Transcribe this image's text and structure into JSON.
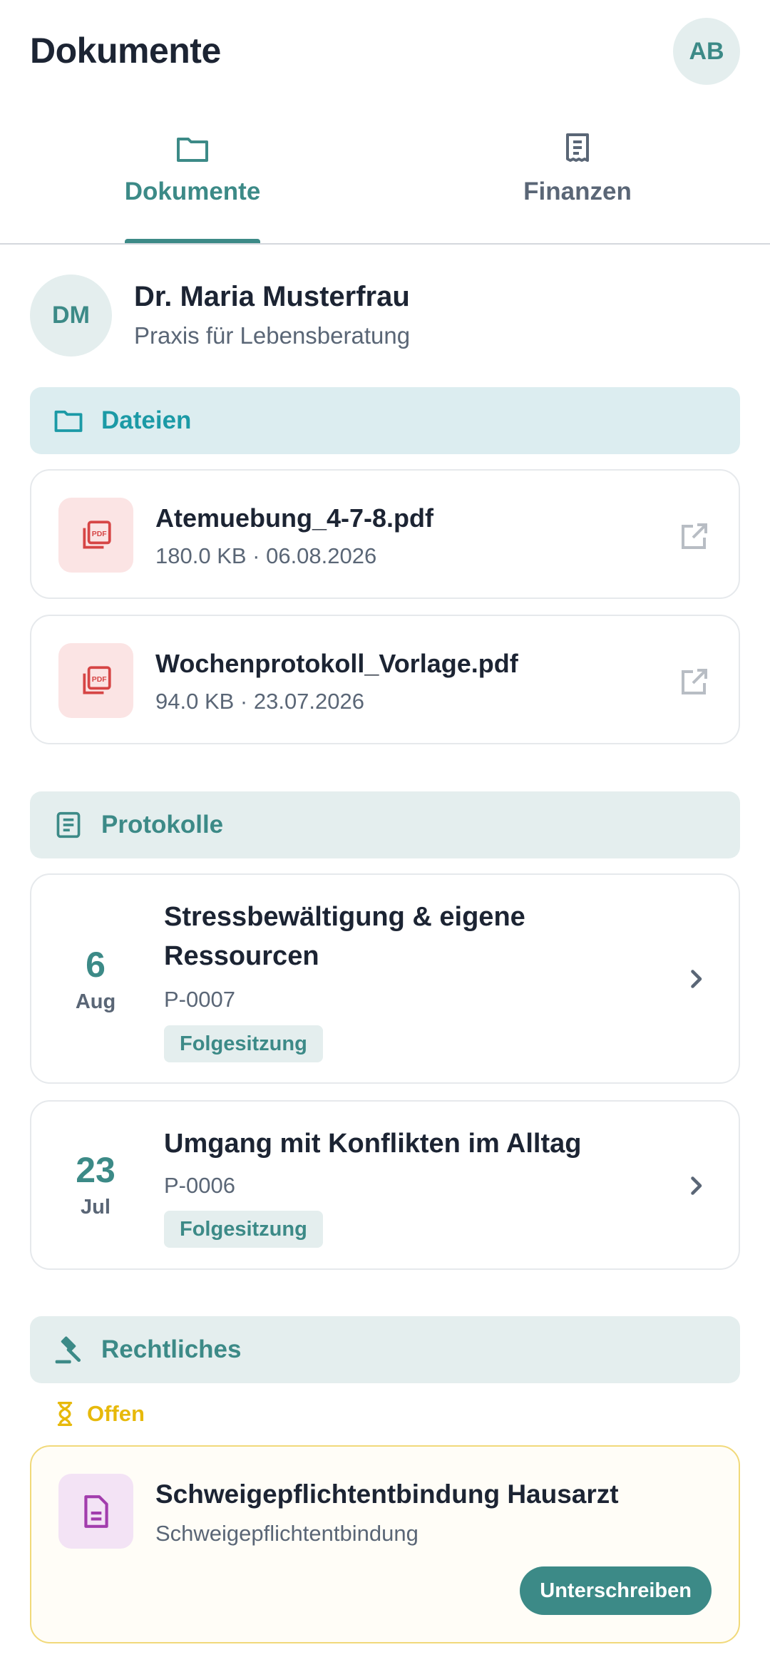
{
  "header": {
    "title": "Dokumente",
    "user_initials": "AB"
  },
  "tabs": [
    {
      "label": "Dokumente",
      "icon": "folder-icon",
      "active": true
    },
    {
      "label": "Finanzen",
      "icon": "receipt-icon",
      "active": false
    }
  ],
  "provider": {
    "initials": "DM",
    "name": "Dr. Maria Musterfrau",
    "subtitle": "Praxis für Lebensberatung"
  },
  "sections": {
    "files": {
      "title": "Dateien",
      "icon": "folder-icon"
    },
    "protocols": {
      "title": "Protokolle",
      "icon": "document-list-icon"
    },
    "legal": {
      "title": "Rechtliches",
      "icon": "gavel-icon"
    }
  },
  "files": [
    {
      "name": "Atemuebung_4-7-8.pdf",
      "meta": "180.0 KB · 06.08.2026",
      "icon": "pdf-icon"
    },
    {
      "name": "Wochenprotokoll_Vorlage.pdf",
      "meta": "94.0 KB · 23.07.2026",
      "icon": "pdf-icon"
    }
  ],
  "protocols": [
    {
      "day": "6",
      "month": "Aug",
      "title": "Stressbewältigung & eigene Ressourcen",
      "id": "P-0007",
      "badge": "Folgesitzung"
    },
    {
      "day": "23",
      "month": "Jul",
      "title": "Umgang mit Konflikten im Alltag",
      "id": "P-0006",
      "badge": "Folgesitzung"
    }
  ],
  "legal": {
    "status_label": "Offen",
    "status_icon": "hourglass-icon",
    "document": {
      "title": "Schweigepflichtentbindung Hausarzt",
      "subtitle": "Schweigepflichtentbindung",
      "button": "Unterschreiben"
    }
  },
  "colors": {
    "accent": "#3c8a87",
    "files_accent": "#1b9aa6",
    "pending": "#e7b90b",
    "pdf": "#d64545"
  }
}
